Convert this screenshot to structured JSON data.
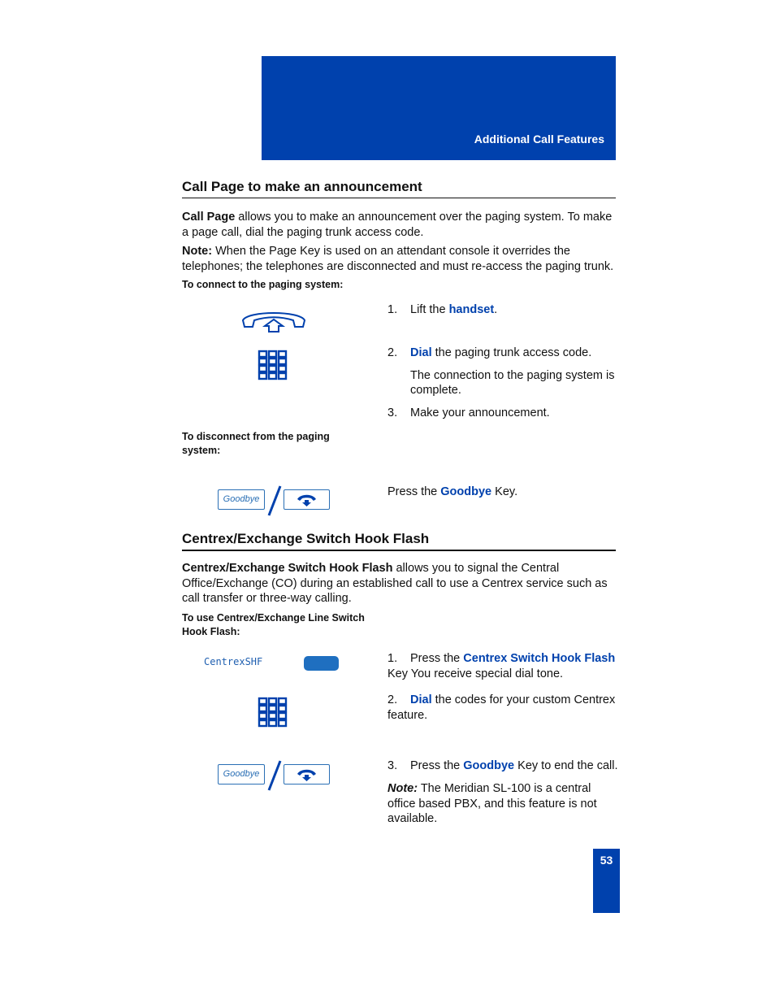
{
  "header": {
    "chapter_title": "Additional Call Features"
  },
  "section1": {
    "title": "Call Page to make an announcement",
    "intro_bold": "Call Page",
    "intro_rest": " allows you to make an announcement over the paging system. To make a page call, dial the paging trunk access code.",
    "note_label": "Note:",
    "note_rest": " When the Page Key is used on an attendant console it overrides the telephones; the telephones are disconnected and must re-access the paging trunk.",
    "connect_heading": "To connect to the paging system:",
    "steps": [
      {
        "num": "1.",
        "pre": "Lift the ",
        "kw": "handset",
        "post": "."
      },
      {
        "num": "2.",
        "pre": "",
        "kw": "Dial",
        "post": " the paging trunk access code.",
        "extra": "The connection to the paging system is complete."
      },
      {
        "num": "3.",
        "pre": "Make your announcement.",
        "kw": "",
        "post": ""
      }
    ],
    "disconnect_heading": "To disconnect from the paging system:",
    "disconnect_step": {
      "pre": "Press the ",
      "kw": "Goodbye",
      "post": " Key."
    },
    "icons": [
      "handset-lift-icon",
      "dialpad-icon",
      "goodbye-key-icon",
      "release-key-icon"
    ]
  },
  "section2": {
    "title": "Centrex/Exchange Switch Hook Flash",
    "intro_bold": "Centrex/Exchange Switch Hook Flash",
    "intro_rest": " allows you to signal the Central Office/Exchange (CO) during an established call to use a Centrex service such as call transfer or three-way calling.",
    "use_heading": "To use Centrex/Exchange Line Switch Hook Flash:",
    "softkey_label": "CentrexSHF",
    "steps": [
      {
        "num": "1.",
        "pre": "Press the ",
        "kw": "Centrex Switch Hook Flash",
        "post": " Key You receive special dial tone."
      },
      {
        "num": "2.",
        "pre": "",
        "kw": "Dial",
        "post": " the codes for your custom Centrex feature."
      },
      {
        "num": "3.",
        "pre": "Press the ",
        "kw": "Goodbye",
        "post": " Key to end the call."
      }
    ],
    "note_label": "Note:",
    "note_rest": " The Meridian SL-100 is a central office based PBX, and this feature is not available."
  },
  "keys": {
    "goodbye_label": "Goodbye"
  },
  "footer": {
    "page_number": "53"
  },
  "colors": {
    "brand_blue": "#0041ad",
    "key_blue": "#2a6fb5"
  }
}
